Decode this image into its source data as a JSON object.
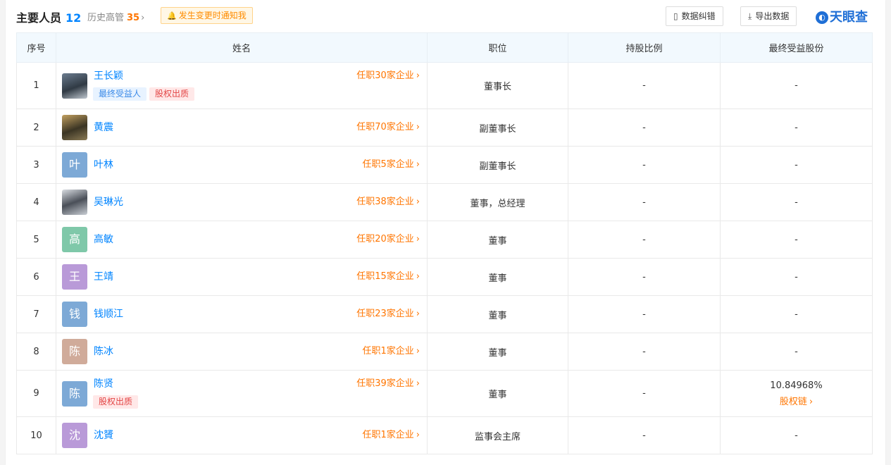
{
  "header": {
    "title": "主要人员",
    "count": "12",
    "history_label": "历史高管",
    "history_count": "35",
    "notify_label": "发生变更时通知我",
    "correct_label": "数据纠错",
    "export_label": "导出数据",
    "logo_text": "天眼查"
  },
  "columns": [
    "序号",
    "姓名",
    "职位",
    "持股比例",
    "最终受益股份"
  ],
  "rows": [
    {
      "no": "1",
      "name": "王长颖",
      "avatar": "photo",
      "tags": [
        "最终受益人",
        "股权出质"
      ],
      "jobs": "任职30家企业",
      "position": "董事长",
      "share": "-",
      "benefit": "-",
      "benefit_link": ""
    },
    {
      "no": "2",
      "name": "黄震",
      "avatar": "photo2",
      "tags": [],
      "jobs": "任职70家企业",
      "position": "副董事长",
      "share": "-",
      "benefit": "-",
      "benefit_link": ""
    },
    {
      "no": "3",
      "name": "叶林",
      "avatar": "叶",
      "avatar_color": "#7da9d6",
      "tags": [],
      "jobs": "任职5家企业",
      "position": "副董事长",
      "share": "-",
      "benefit": "-",
      "benefit_link": ""
    },
    {
      "no": "4",
      "name": "吴琳光",
      "avatar": "photo3",
      "tags": [],
      "jobs": "任职38家企业",
      "position": "董事，总经理",
      "share": "-",
      "benefit": "-",
      "benefit_link": ""
    },
    {
      "no": "5",
      "name": "高敏",
      "avatar": "高",
      "avatar_color": "#7fc8a9",
      "tags": [],
      "jobs": "任职20家企业",
      "position": "董事",
      "share": "-",
      "benefit": "-",
      "benefit_link": ""
    },
    {
      "no": "6",
      "name": "王靖",
      "avatar": "王",
      "avatar_color": "#b99ad8",
      "tags": [],
      "jobs": "任职15家企业",
      "position": "董事",
      "share": "-",
      "benefit": "-",
      "benefit_link": ""
    },
    {
      "no": "7",
      "name": "钱顺江",
      "avatar": "钱",
      "avatar_color": "#7da9d6",
      "tags": [],
      "jobs": "任职23家企业",
      "position": "董事",
      "share": "-",
      "benefit": "-",
      "benefit_link": ""
    },
    {
      "no": "8",
      "name": "陈冰",
      "avatar": "陈",
      "avatar_color": "#d0ab9a",
      "tags": [],
      "jobs": "任职1家企业",
      "position": "董事",
      "share": "-",
      "benefit": "-",
      "benefit_link": ""
    },
    {
      "no": "9",
      "name": "陈贤",
      "avatar": "陈",
      "avatar_color": "#7da9d6",
      "tags": [
        "股权出质"
      ],
      "jobs": "任职39家企业",
      "position": "董事",
      "share": "-",
      "benefit": "10.84968%",
      "benefit_link": "股权链"
    },
    {
      "no": "10",
      "name": "沈贇",
      "avatar": "沈",
      "avatar_color": "#b99ad8",
      "tags": [],
      "jobs": "任职1家企业",
      "position": "监事会主席",
      "share": "-",
      "benefit": "-",
      "benefit_link": ""
    }
  ],
  "colors": {
    "accent": "#0084ff",
    "orange": "#ff7500",
    "header_bg": "#f2f9fe"
  }
}
